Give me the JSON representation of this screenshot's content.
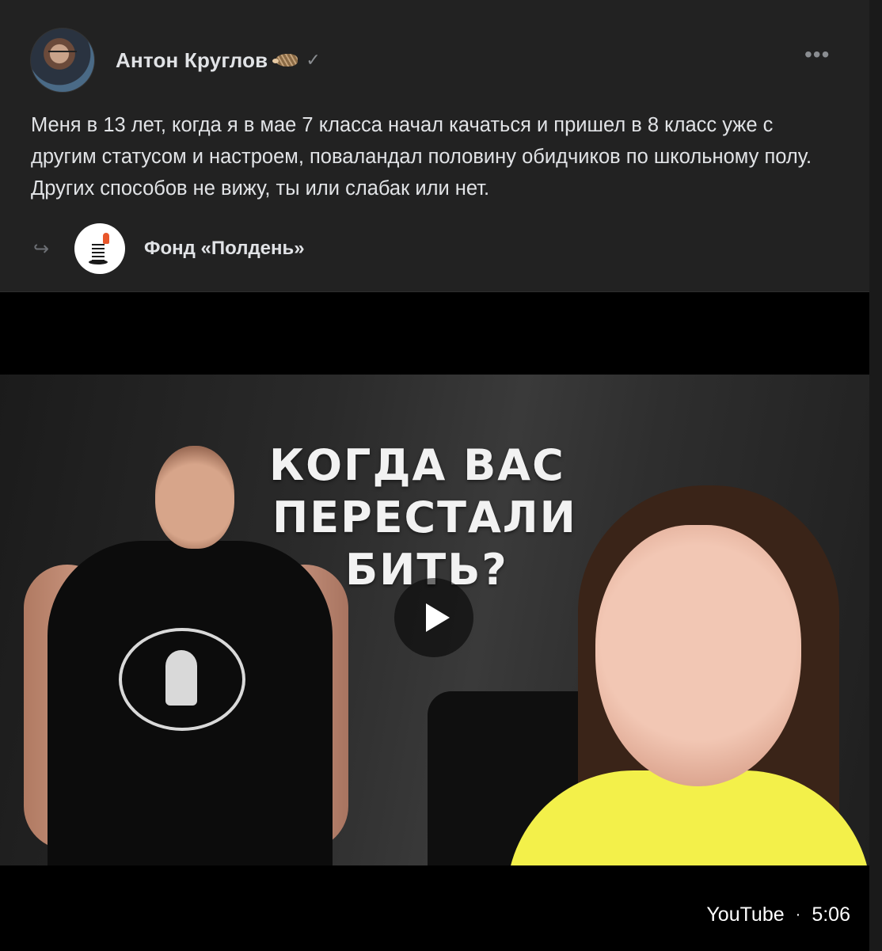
{
  "post": {
    "author": {
      "name": "Антон Круглов",
      "badge_icon": "hedgehog-icon",
      "verified_icon": "check-icon"
    },
    "more_icon": "•••",
    "text": "Меня в 13 лет, когда я в мае 7 класса начал качаться и пришел в 8 класс уже с другим статусом и настроем, поваландал половину обидчиков по школьному полу. Других способов не вижу, ты или слабак или нет.",
    "repost": {
      "icon": "repost-icon",
      "group_name": "Фонд «Полдень»"
    },
    "video": {
      "headline": [
        "КОГДА ВАС",
        "ПЕРЕСТАЛИ",
        "БИТЬ?"
      ],
      "source": "YouTube",
      "separator": "·",
      "duration": "5:06"
    }
  },
  "colors": {
    "background": "#222222",
    "text": "#e1e3e6",
    "muted": "#8a8d91",
    "video_bg": "#000000"
  }
}
